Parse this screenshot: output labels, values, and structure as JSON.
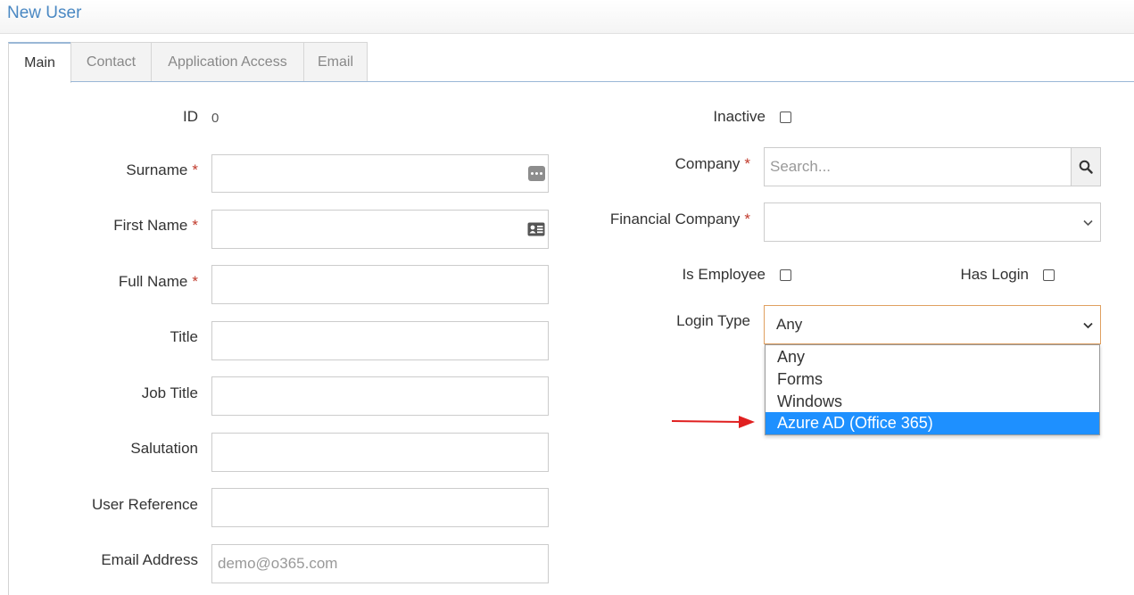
{
  "page": {
    "title": "New User"
  },
  "tabs": [
    {
      "label": "Main",
      "active": true
    },
    {
      "label": "Contact",
      "active": false
    },
    {
      "label": "Application Access",
      "active": false
    },
    {
      "label": "Email",
      "active": false
    }
  ],
  "left_form": {
    "id_label": "ID",
    "id_value": "0",
    "surname_label": "Surname",
    "first_name_label": "First Name",
    "full_name_label": "Full Name",
    "title_label": "Title",
    "job_title_label": "Job Title",
    "salutation_label": "Salutation",
    "user_reference_label": "User Reference",
    "email_label": "Email Address",
    "email_value": "demo@o365.com",
    "required_mark": "*"
  },
  "right_form": {
    "inactive_label": "Inactive",
    "company_label": "Company",
    "company_placeholder": "Search...",
    "financial_company_label": "Financial Company",
    "is_employee_label": "Is Employee",
    "has_login_label": "Has Login",
    "login_type_label": "Login Type",
    "login_type_value": "Any",
    "login_type_options": [
      "Any",
      "Forms",
      "Windows",
      "Azure AD (Office 365)"
    ],
    "login_type_highlighted": "Azure AD (Office 365)"
  },
  "colors": {
    "accent": "#4a88c3",
    "required": "#c0392b",
    "highlight": "#1e90ff",
    "focus_border": "#e0a060",
    "annotation_arrow": "#e02020"
  },
  "icons": {
    "surname_field": "ellipsis-icon",
    "first_name_field": "id-card-icon",
    "company_search": "search-icon",
    "select_arrow": "chevron-down-icon",
    "annotation": "red-arrow-icon"
  }
}
